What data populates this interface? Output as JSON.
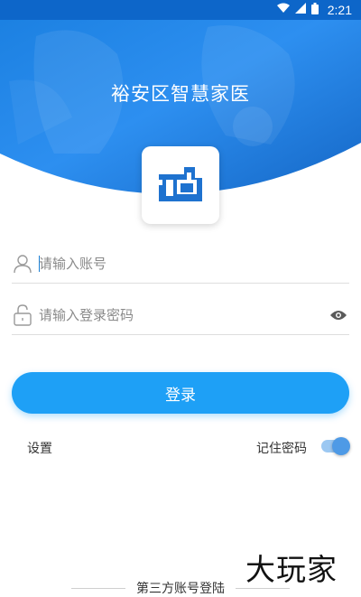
{
  "status_bar": {
    "time": "2:21"
  },
  "header": {
    "title": "裕安区智慧家医"
  },
  "login_form": {
    "account_placeholder": "请输入账号",
    "password_placeholder": "请输入登录密码",
    "login_label": "登录",
    "settings_label": "设置",
    "remember_label": "记住密码",
    "remember_enabled": true
  },
  "footer": {
    "third_party_label": "第三方账号登陆"
  },
  "watermark": {
    "text": "大玩家"
  },
  "colors": {
    "primary": "#1ea0f6",
    "header_dark": "#0d66c9",
    "logo_blue": "#1e72cf"
  }
}
